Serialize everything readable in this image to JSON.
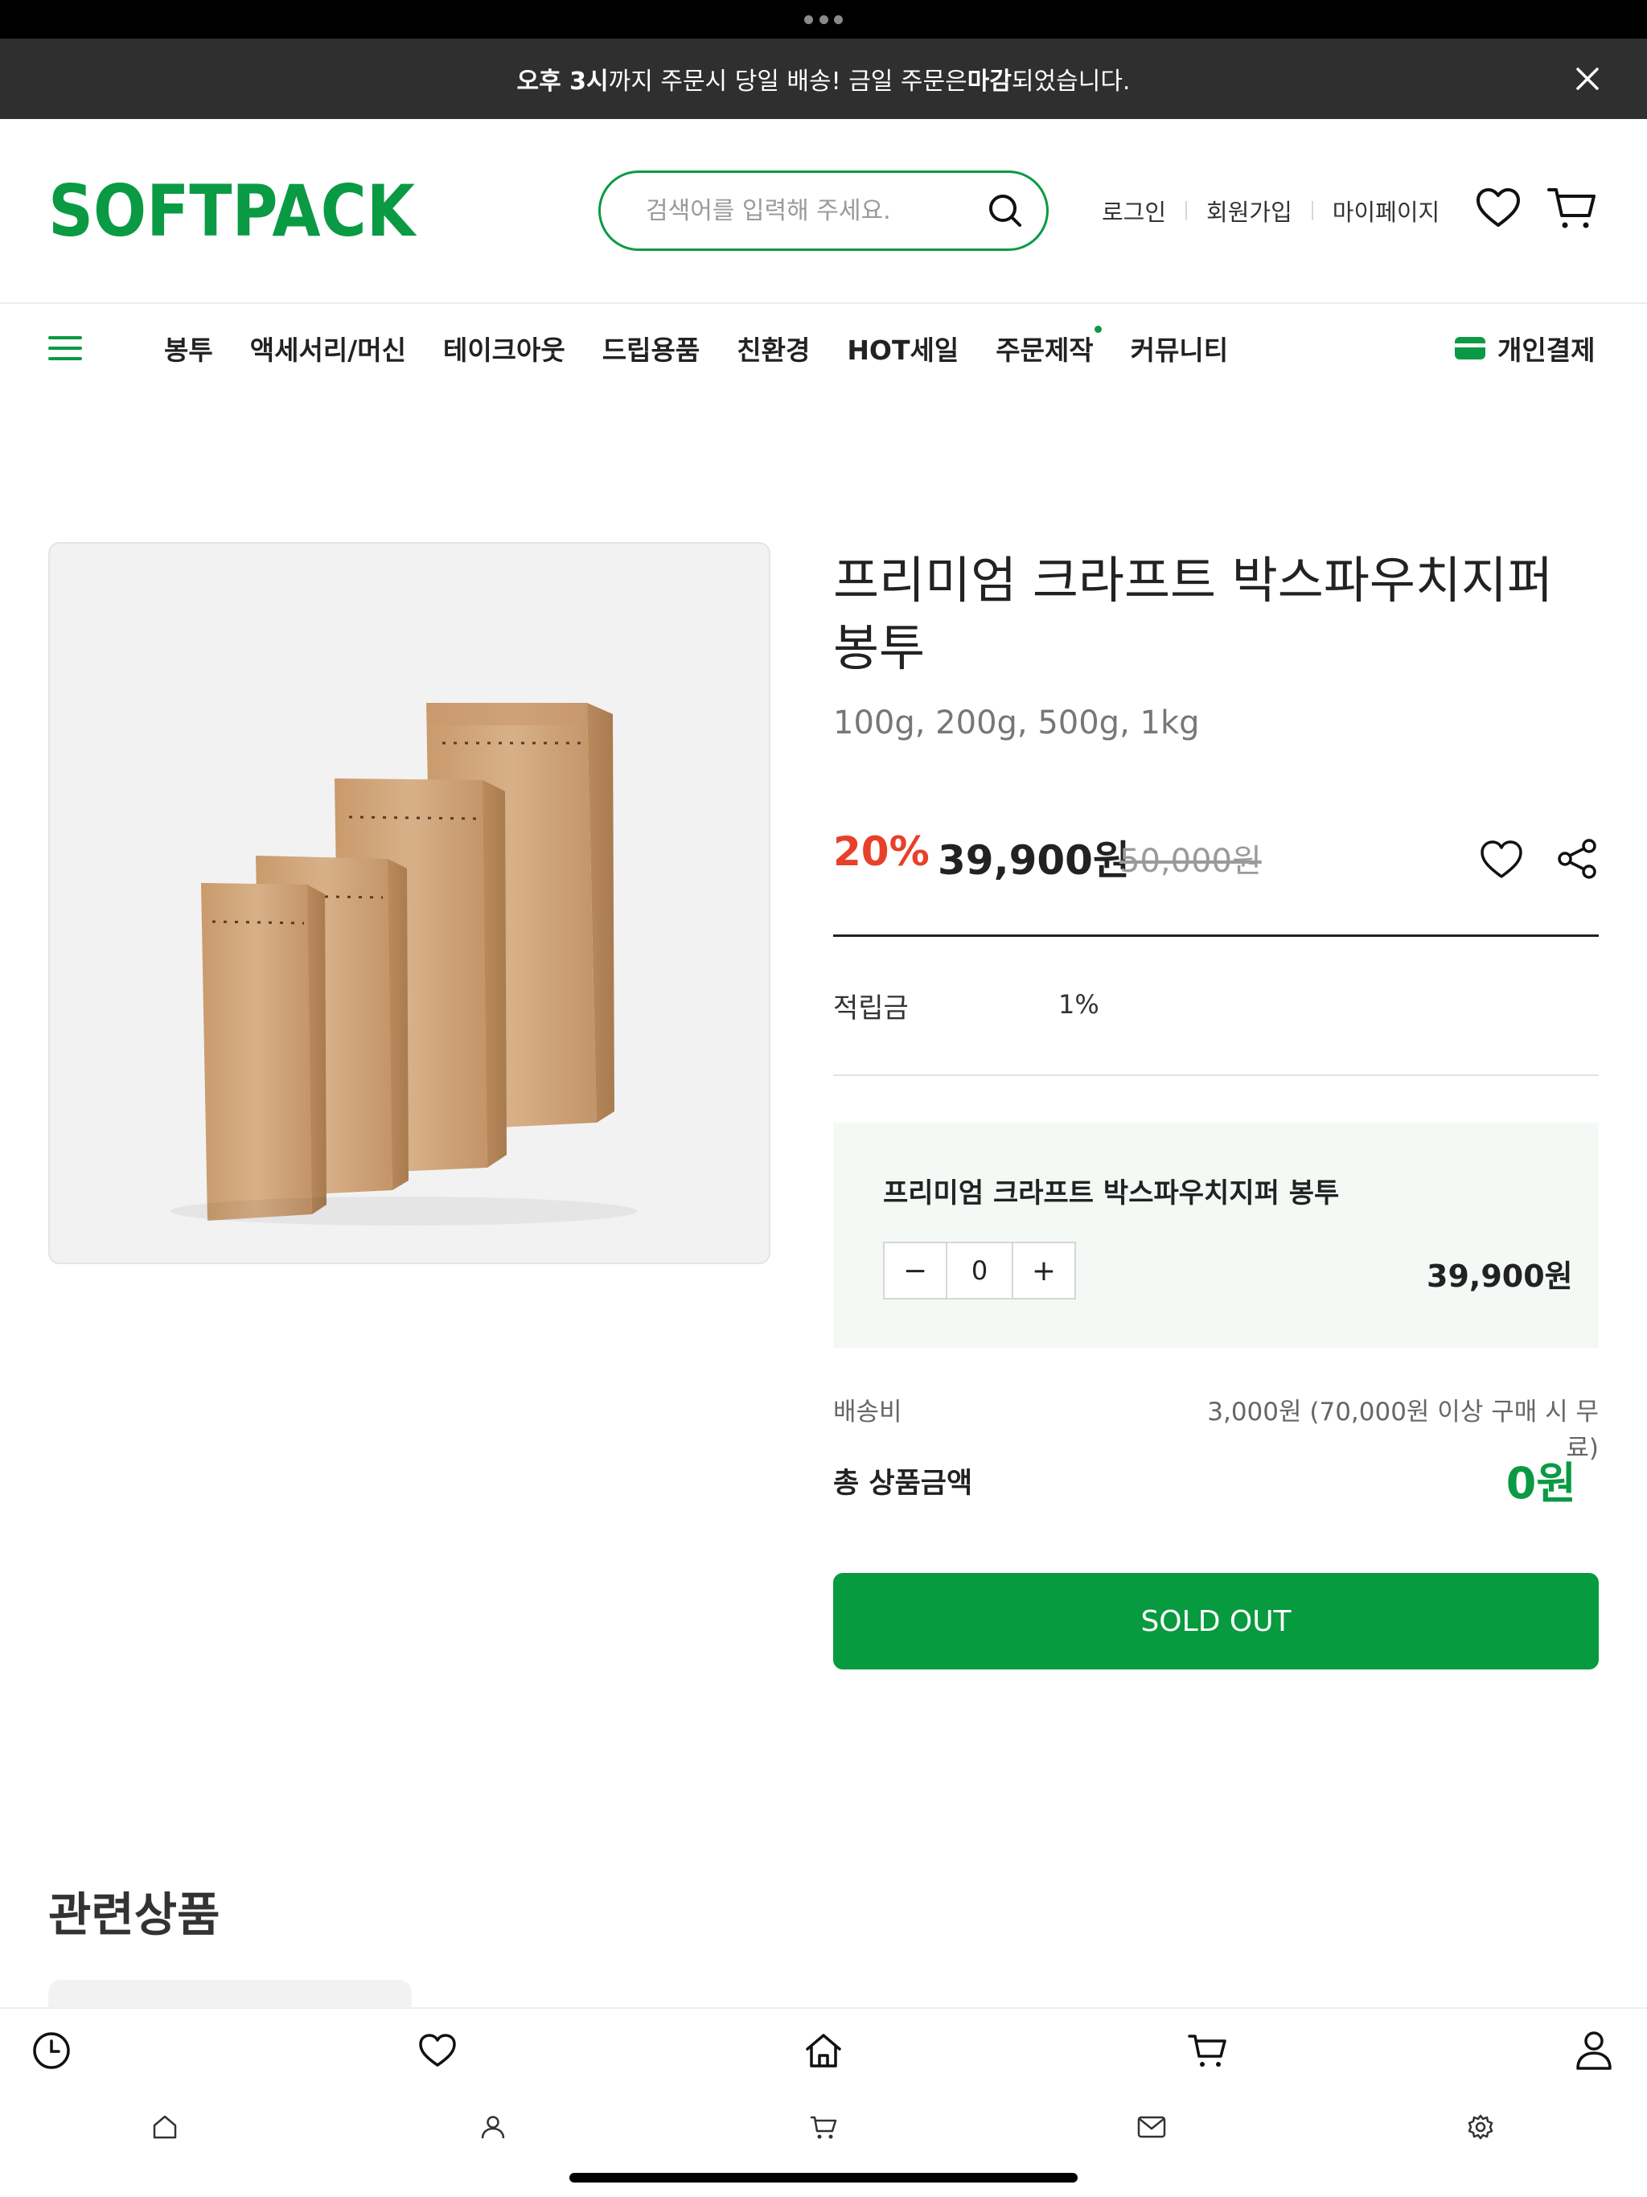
{
  "announcement": {
    "part1_bold": "오후 3시",
    "part2": "까지 주문시 당일 배송! 금일 주문은 ",
    "part3_bold": "마감",
    "part4": "되었습니다."
  },
  "header": {
    "logo": "SOFTPACK",
    "search_placeholder": "검색어를 입력해 주세요.",
    "login": "로그인",
    "signup": "회원가입",
    "mypage": "마이페이지"
  },
  "nav": {
    "items": [
      "봉투",
      "액세서리/머신",
      "테이크아웃",
      "드립용품",
      "친환경",
      "HOT세일",
      "주문제작",
      "커뮤니티"
    ],
    "private_pay": "개인결제"
  },
  "product": {
    "title": "프리미엄 크라프트 박스파우치지퍼 봉투",
    "subtitle": "100g, 200g, 500g, 1kg",
    "discount": "20%",
    "price": "39,900원",
    "original_price": "50,000원",
    "points_label": "적립금",
    "points_value": "1%",
    "option_name": "프리미엄 크라프트 박스파우치지퍼 봉투",
    "quantity": "0",
    "option_price": "39,900원",
    "shipping_label": "배송비",
    "shipping_value": "3,000원 (70,000원 이상 구매 시 무료)",
    "total_label": "총 상품금액",
    "total_value": "0원",
    "sold_out_label": "SOLD OUT"
  },
  "related": {
    "title": "관련상품"
  },
  "colors": {
    "brand_green": "#0a9a43",
    "discount_red": "#e8402a",
    "announcement_bg": "#2f2f2f"
  },
  "icons": {
    "toolbar_row1": [
      "clock-icon",
      "heart-icon",
      "home-icon",
      "cart-icon",
      "user-icon"
    ],
    "toolbar_row2": [
      "home-icon",
      "user-icon",
      "cart-icon",
      "mail-icon",
      "gear-icon"
    ]
  }
}
